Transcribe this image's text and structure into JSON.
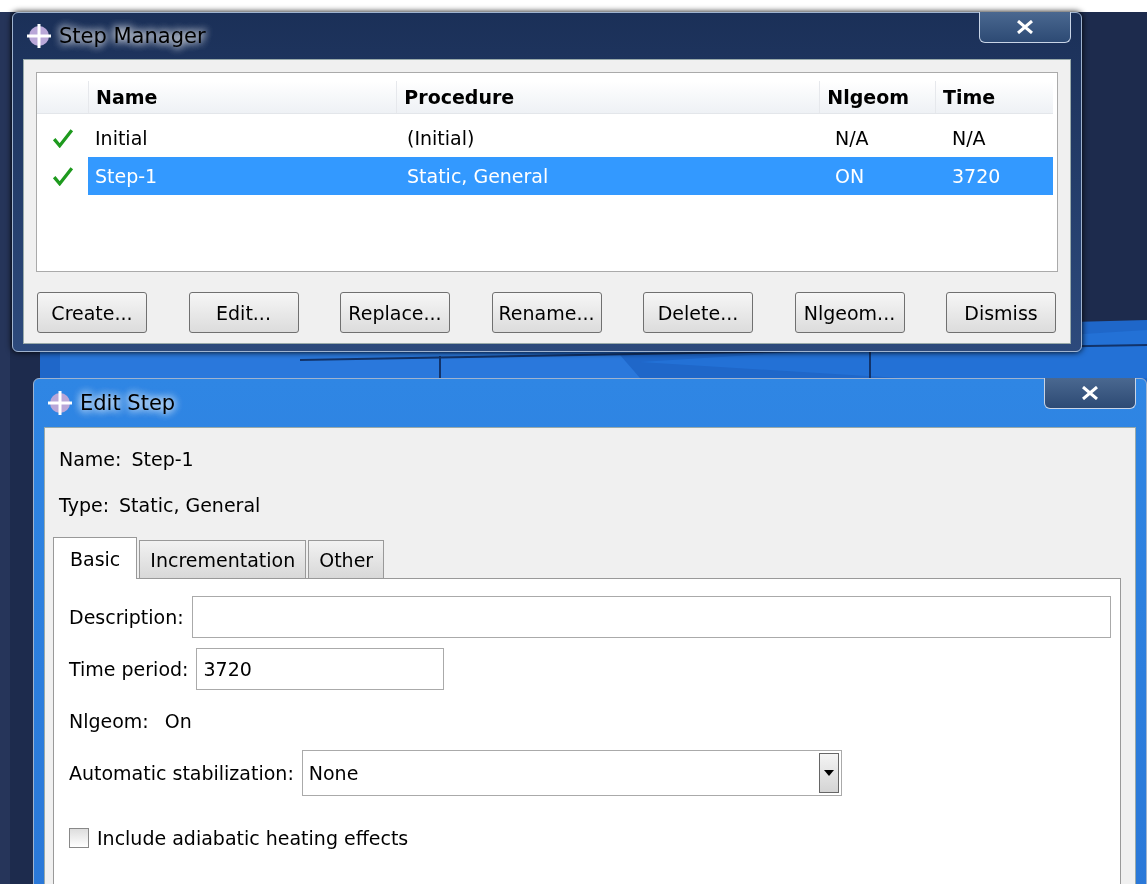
{
  "step_manager": {
    "title": "Step Manager",
    "table": {
      "columns": [
        "Name",
        "Procedure",
        "Nlgeom",
        "Time"
      ],
      "rows": [
        {
          "status_ok": true,
          "selected": false,
          "cells": [
            "Initial",
            "(Initial)",
            "N/A",
            "N/A"
          ]
        },
        {
          "status_ok": true,
          "selected": true,
          "cells": [
            "Step-1",
            "Static, General",
            "ON",
            "3720"
          ]
        }
      ]
    },
    "buttons": [
      "Create...",
      "Edit...",
      "Replace...",
      "Rename...",
      "Delete...",
      "Nlgeom...",
      "Dismiss"
    ]
  },
  "edit_step": {
    "title": "Edit Step",
    "name": {
      "label": "Name:",
      "value": "Step-1"
    },
    "type": {
      "label": "Type:",
      "value": "Static, General"
    },
    "tabs": [
      {
        "label": "Basic",
        "selected": true
      },
      {
        "label": "Incrementation",
        "selected": false
      },
      {
        "label": "Other",
        "selected": false
      }
    ],
    "description": {
      "label": "Description:"
    },
    "time_period": {
      "label": "Time period:",
      "value": "3720"
    },
    "nlgeom": {
      "label": "Nlgeom:",
      "value": "On"
    },
    "stabilization": {
      "label": "Automatic stabilization:",
      "value": "None"
    },
    "adiabatic": {
      "label": "Include adiabatic heating effects",
      "checked": false
    }
  }
}
